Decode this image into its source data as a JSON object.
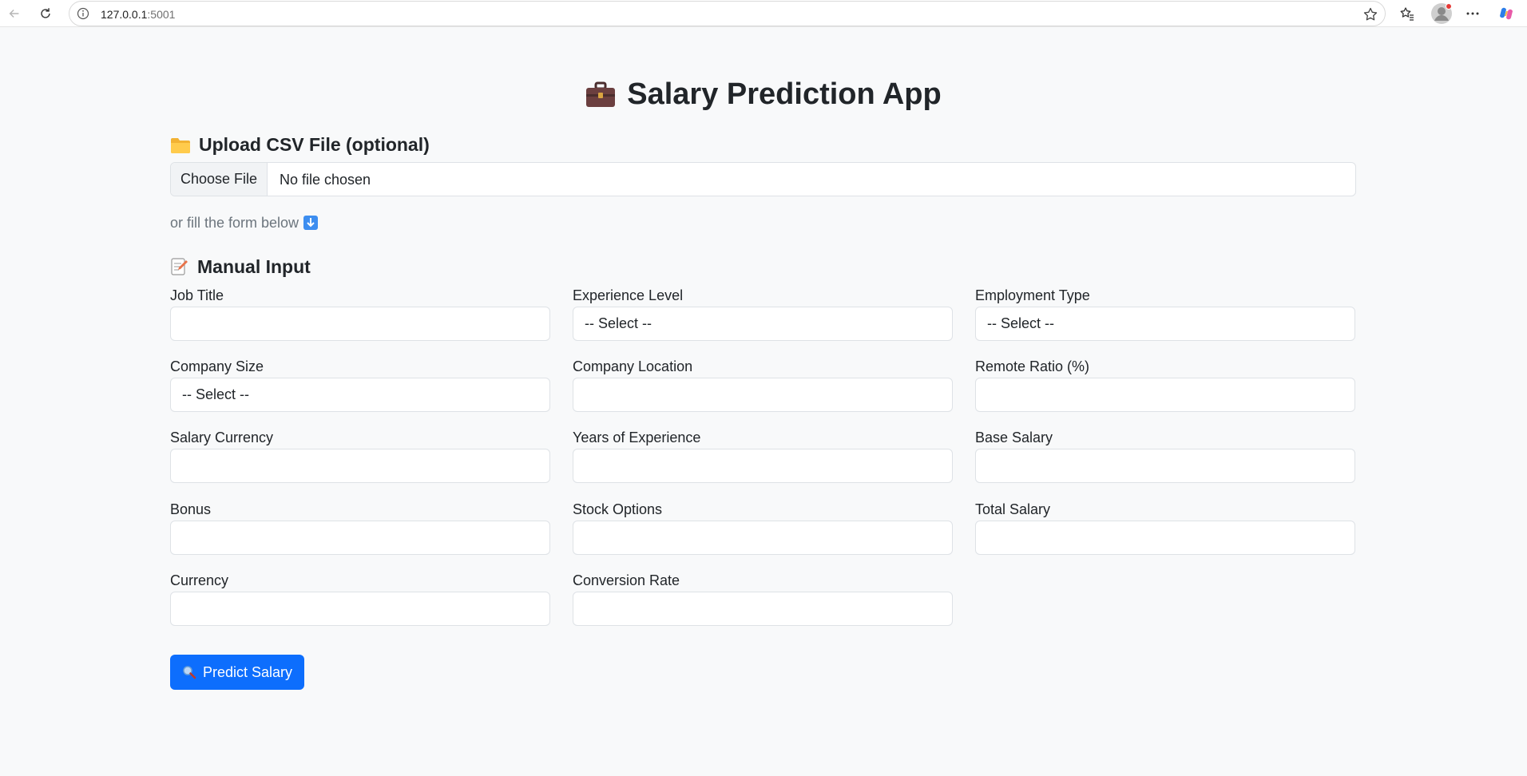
{
  "browser": {
    "url_host": "127.0.0.1",
    "url_port": ":5001"
  },
  "app": {
    "title": "Salary Prediction App"
  },
  "upload": {
    "heading": "Upload CSV File (optional)",
    "choose_file_label": "Choose File",
    "file_status": "No file chosen"
  },
  "hint_text": "or fill the form below",
  "manual": {
    "heading": "Manual Input",
    "fields": [
      {
        "label": "Job Title",
        "type": "text",
        "value": ""
      },
      {
        "label": "Experience Level",
        "type": "select",
        "value": "-- Select --"
      },
      {
        "label": "Employment Type",
        "type": "select",
        "value": "-- Select --"
      },
      {
        "label": "Company Size",
        "type": "select",
        "value": "-- Select --"
      },
      {
        "label": "Company Location",
        "type": "text",
        "value": ""
      },
      {
        "label": "Remote Ratio (%)",
        "type": "text",
        "value": ""
      },
      {
        "label": "Salary Currency",
        "type": "text",
        "value": ""
      },
      {
        "label": "Years of Experience",
        "type": "text",
        "value": ""
      },
      {
        "label": "Base Salary",
        "type": "text",
        "value": ""
      },
      {
        "label": "Bonus",
        "type": "text",
        "value": ""
      },
      {
        "label": "Stock Options",
        "type": "text",
        "value": ""
      },
      {
        "label": "Total Salary",
        "type": "text",
        "value": ""
      },
      {
        "label": "Currency",
        "type": "text",
        "value": ""
      },
      {
        "label": "Conversion Rate",
        "type": "text",
        "value": ""
      }
    ]
  },
  "predict_button": "Predict Salary",
  "colors": {
    "primary": "#0d6efd",
    "page_bg": "#f8f9fa",
    "border": "#dee2e6"
  }
}
